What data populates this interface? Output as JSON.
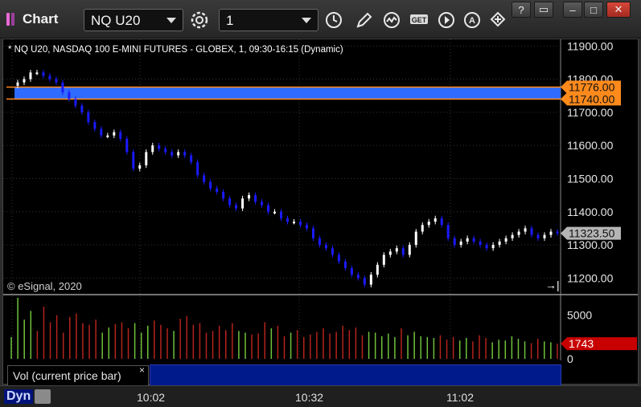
{
  "window": {
    "title": "Chart",
    "symbol_value": "NQ U20",
    "interval_value": "1",
    "controls": [
      "help-icon",
      "restore-icon",
      "minimize-icon",
      "maximize-icon",
      "close-icon"
    ]
  },
  "toolbar": {
    "icons": [
      "settings-gear-icon",
      "clock-icon",
      "pencil-draw-icon",
      "study-wave-icon",
      "get-data-icon",
      "play-icon",
      "annotation-a-icon",
      "link-arrows-icon"
    ],
    "get_label": "GET",
    "a_label": "A"
  },
  "chart": {
    "header": "* NQ U20, NASDAQ 100 E-MINI FUTURES - GLOBEX, 1, 09:30-16:15 (Dynamic)",
    "copyright": "© eSignal, 2020",
    "price_ticks": [
      "11900.00",
      "11800.00",
      "11700.00",
      "11600.00",
      "11500.00",
      "11400.00",
      "11300.00",
      "11200.00"
    ],
    "marker_upper": "11776.00",
    "marker_lower": "11740.00",
    "last_price": "11323.50",
    "volume_ticks": [
      "5000",
      "0"
    ],
    "last_volume": "1743",
    "volume_legend": "Vol (current price bar)",
    "volume_legend_close": "×",
    "jump_icon": "→|",
    "times": [
      "10:02",
      "10:32",
      "11:02"
    ],
    "dyn_label": "Dyn",
    "colors": {
      "up": "#ffffff",
      "down": "#1a1aff",
      "vol_up": "#6fc23a",
      "vol_down": "#b4231c",
      "marker": "#ff8a1c",
      "band": "#2f6bff",
      "last_price_bg": "#b5b5b5",
      "last_volume_bg": "#c80000"
    }
  },
  "chart_data": {
    "type": "candlestick",
    "title": "* NQ U20, NASDAQ 100 E-MINI FUTURES - GLOBEX, 1, 09:30-16:15 (Dynamic)",
    "y_axis": {
      "min": 11150,
      "max": 11920,
      "ticks": [
        11900,
        11800,
        11700,
        11600,
        11500,
        11400,
        11300,
        11200
      ]
    },
    "x_ticks": [
      "10:02",
      "10:32",
      "11:02"
    ],
    "closes": [
      11790,
      11800,
      11820,
      11820,
      11810,
      11800,
      11790,
      11760,
      11740,
      11720,
      11700,
      11670,
      11650,
      11630,
      11630,
      11640,
      11620,
      11580,
      11530,
      11540,
      11580,
      11600,
      11590,
      11580,
      11570,
      11580,
      11570,
      11550,
      11510,
      11490,
      11470,
      11460,
      11440,
      11420,
      11410,
      11440,
      11450,
      11430,
      11420,
      11400,
      11400,
      11380,
      11370,
      11370,
      11360,
      11350,
      11320,
      11300,
      11290,
      11270,
      11250,
      11230,
      11210,
      11200,
      11180,
      11210,
      11240,
      11270,
      11280,
      11290,
      11270,
      11300,
      11340,
      11360,
      11370,
      11380,
      11360,
      11320,
      11300,
      11310,
      11320,
      11310,
      11300,
      11290,
      11300,
      11310,
      11320,
      11330,
      11340,
      11350,
      11330,
      11320,
      11330,
      11340,
      11335
    ],
    "volume_axis": {
      "min": 0,
      "max": 7000,
      "ticks": [
        5000,
        0
      ]
    },
    "volumes": [
      2500,
      7000,
      4500,
      5500,
      3200,
      6000,
      4200,
      5000,
      3000,
      4800,
      5200,
      4100,
      3900,
      4500,
      3000,
      3600,
      4000,
      4200,
      3500,
      4100,
      3000,
      3800,
      4400,
      3900,
      3500,
      3200,
      4600,
      4900,
      3900,
      4100,
      3000,
      3200,
      3800,
      3300,
      4100,
      3200,
      3000,
      2800,
      2900,
      4200,
      3500,
      3800,
      2600,
      3000,
      3300,
      2500,
      2800,
      3100,
      3500,
      2900,
      3100,
      3800,
      3300,
      3600,
      2700,
      3100,
      3000,
      2600,
      2900,
      2500,
      3500,
      2700,
      3100,
      2600,
      2500,
      2400,
      2700,
      2200,
      2500,
      2100,
      2400,
      2000,
      2700,
      2400,
      1900,
      2200,
      2100,
      2600,
      2300,
      2000,
      1800,
      2300,
      2000,
      1900,
      1743
    ]
  }
}
